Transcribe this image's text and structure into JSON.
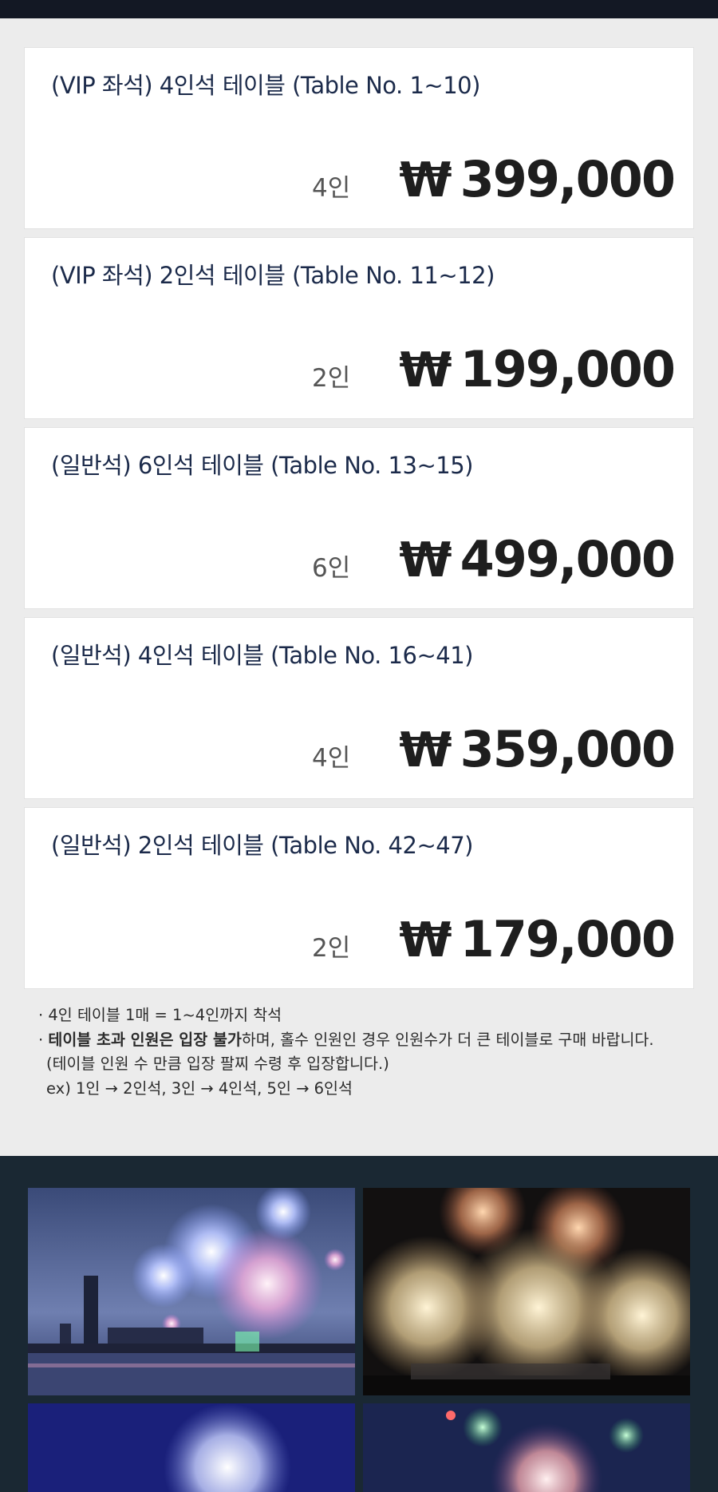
{
  "tables": [
    {
      "title": "(VIP 좌석) 4인석 테이블 (Table No. 1~10)",
      "people": "4인",
      "currency": "₩",
      "price": "399,000"
    },
    {
      "title": "(VIP 좌석) 2인석 테이블 (Table No. 11~12)",
      "people": "2인",
      "currency": "₩",
      "price": "199,000"
    },
    {
      "title": "(일반석) 6인석 테이블 (Table No. 13~15)",
      "people": "6인",
      "currency": "₩",
      "price": "499,000"
    },
    {
      "title": "(일반석) 4인석 테이블 (Table No. 16~41)",
      "people": "4인",
      "currency": "₩",
      "price": "359,000"
    },
    {
      "title": "(일반석) 2인석 테이블 (Table No. 42~47)",
      "people": "2인",
      "currency": "₩",
      "price": "179,000"
    }
  ],
  "notes": {
    "line1": "· 4인 테이블 1매 = 1~4인까지 착석",
    "line2_prefix": "· ",
    "line2_bold": "테이블 초과 인원은 입장 불가",
    "line2_rest": "하며, 홀수 인원인 경우 인원수가 더 큰 테이블로 구매 바랍니다.",
    "line3": "(테이블 인원 수 만큼 입장 팔찌 수령 후 입장합니다.)",
    "line4": "ex) 1인 → 2인석, 3인 → 4인석, 5인 → 6인석"
  },
  "colors": {
    "top_bar": "#131824",
    "page_background": "#ececec",
    "card_title": "#1b2a4a",
    "price": "#1e1e1e",
    "gallery_background": "#1a2833"
  },
  "gallery": {
    "photos": [
      "fireworks-city-bridge",
      "fireworks-gold-burst",
      "fireworks-blue-night",
      "fireworks-green-sparks"
    ]
  }
}
